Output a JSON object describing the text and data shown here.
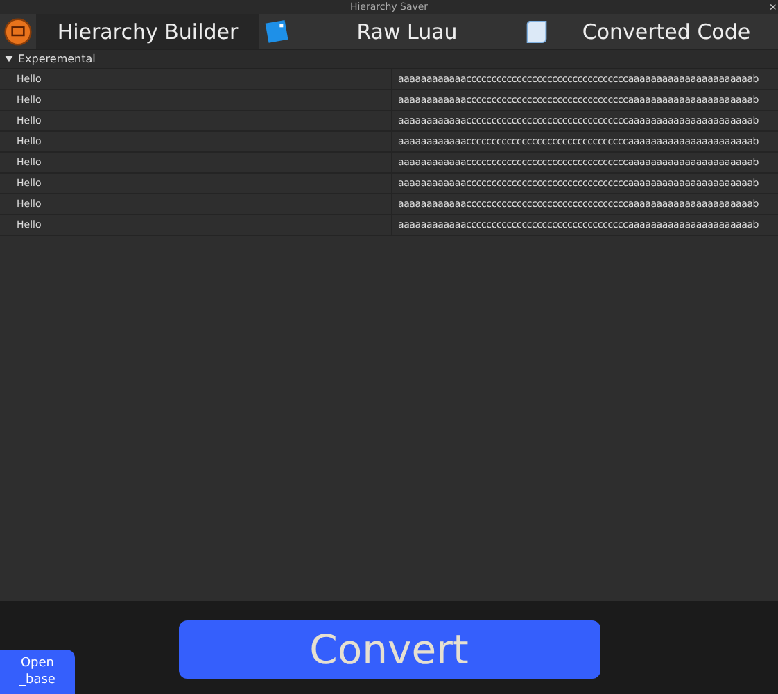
{
  "window": {
    "title": "Hierarchy Saver",
    "close": "×"
  },
  "tabs": [
    {
      "label": "Hierarchy Builder",
      "kind": "orange",
      "selected": true
    },
    {
      "label": "Raw Luau",
      "kind": "luau",
      "selected": false
    },
    {
      "label": "Converted Code",
      "kind": "scroll",
      "selected": false
    }
  ],
  "section": {
    "title": "Experemental",
    "expanded": true
  },
  "rows": [
    {
      "name": "Hello",
      "value": "aaaaaaaaaaaaccccccccccccccccccccccccccccccccaaaaaaaaaaaaaaaaaaaaaab"
    },
    {
      "name": "Hello",
      "value": "aaaaaaaaaaaaccccccccccccccccccccccccccccccccaaaaaaaaaaaaaaaaaaaaaab"
    },
    {
      "name": "Hello",
      "value": "aaaaaaaaaaaaccccccccccccccccccccccccccccccccaaaaaaaaaaaaaaaaaaaaaab"
    },
    {
      "name": "Hello",
      "value": "aaaaaaaaaaaaccccccccccccccccccccccccccccccccaaaaaaaaaaaaaaaaaaaaaab"
    },
    {
      "name": "Hello",
      "value": "aaaaaaaaaaaaccccccccccccccccccccccccccccccccaaaaaaaaaaaaaaaaaaaaaab"
    },
    {
      "name": "Hello",
      "value": "aaaaaaaaaaaaccccccccccccccccccccccccccccccccaaaaaaaaaaaaaaaaaaaaaab"
    },
    {
      "name": "Hello",
      "value": "aaaaaaaaaaaaccccccccccccccccccccccccccccccccaaaaaaaaaaaaaaaaaaaaaab"
    },
    {
      "name": "Hello",
      "value": "aaaaaaaaaaaaccccccccccccccccccccccccccccccccaaaaaaaaaaaaaaaaaaaaaab"
    }
  ],
  "convert_button": "Convert",
  "open_base_button": "Open _base"
}
